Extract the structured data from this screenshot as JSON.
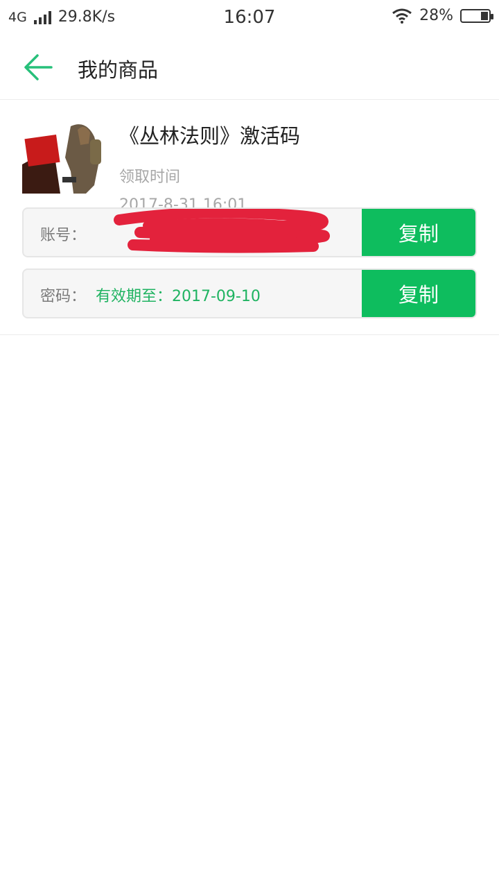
{
  "status_bar": {
    "network": "4G",
    "speed": "29.8K/s",
    "time": "16:07",
    "battery": "28%"
  },
  "header": {
    "title": "我的商品"
  },
  "product": {
    "title": "《丛林法则》激活码",
    "received_label": "领取时间",
    "received_time": "2017-8-31 16:01",
    "thumbnail_icon": "game-cover-image"
  },
  "account_field": {
    "label": "账号：",
    "value": "",
    "copy_label": "复制"
  },
  "password_field": {
    "label": "密码：",
    "value": "有效期至：2017-09-10",
    "copy_label": "复制"
  },
  "colors": {
    "accent_green": "#0ebd5e",
    "back_arrow": "#27c07a",
    "redaction": "#e3223c"
  }
}
